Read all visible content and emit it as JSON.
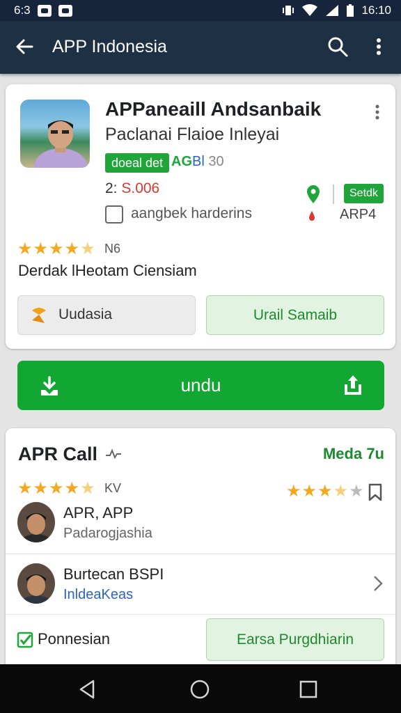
{
  "status_bar": {
    "time_left": "6:3",
    "time_right": "16:10"
  },
  "toolbar": {
    "title": "APP Indonesia"
  },
  "app": {
    "title": "APPaneaill Andsanbaik",
    "subtitle": "Paclanai Flaioe Inleyai",
    "category_pill": "doeal det",
    "tag_a": "AG",
    "tag_b": "Bl",
    "tag_c": "30",
    "version_prefix": "2:",
    "version_value": "S.006",
    "select_badge": "Setdk",
    "developer": "aangbek harderins",
    "rank_label": "ARP4",
    "rating_count": "N6",
    "description": "Derdak lHeotam Ciensiam",
    "btn_secondary": "Uudasia",
    "btn_primary_outline": "Urail Samaib",
    "download_label": "undu"
  },
  "reviews": {
    "title": "APR Call",
    "link": "Meda 7u",
    "rating_count": "KV",
    "items": [
      {
        "name": "APR, APP",
        "sub": "Padarogjashia"
      },
      {
        "name": "Burtecan BSPI",
        "sub": "InldeaKeas"
      }
    ],
    "perm_label": "Ponnesian",
    "perm_button": "Earsa Purgdhiarin"
  },
  "colors": {
    "accent_green": "#12a632",
    "toolbar": "#1d3044",
    "star": "#f4a81f"
  },
  "icons": [
    "back-arrow-icon",
    "search-icon",
    "more-vert-icon",
    "download-icon",
    "share-icon",
    "bookmark-icon",
    "chevron-right-icon",
    "check-icon"
  ]
}
